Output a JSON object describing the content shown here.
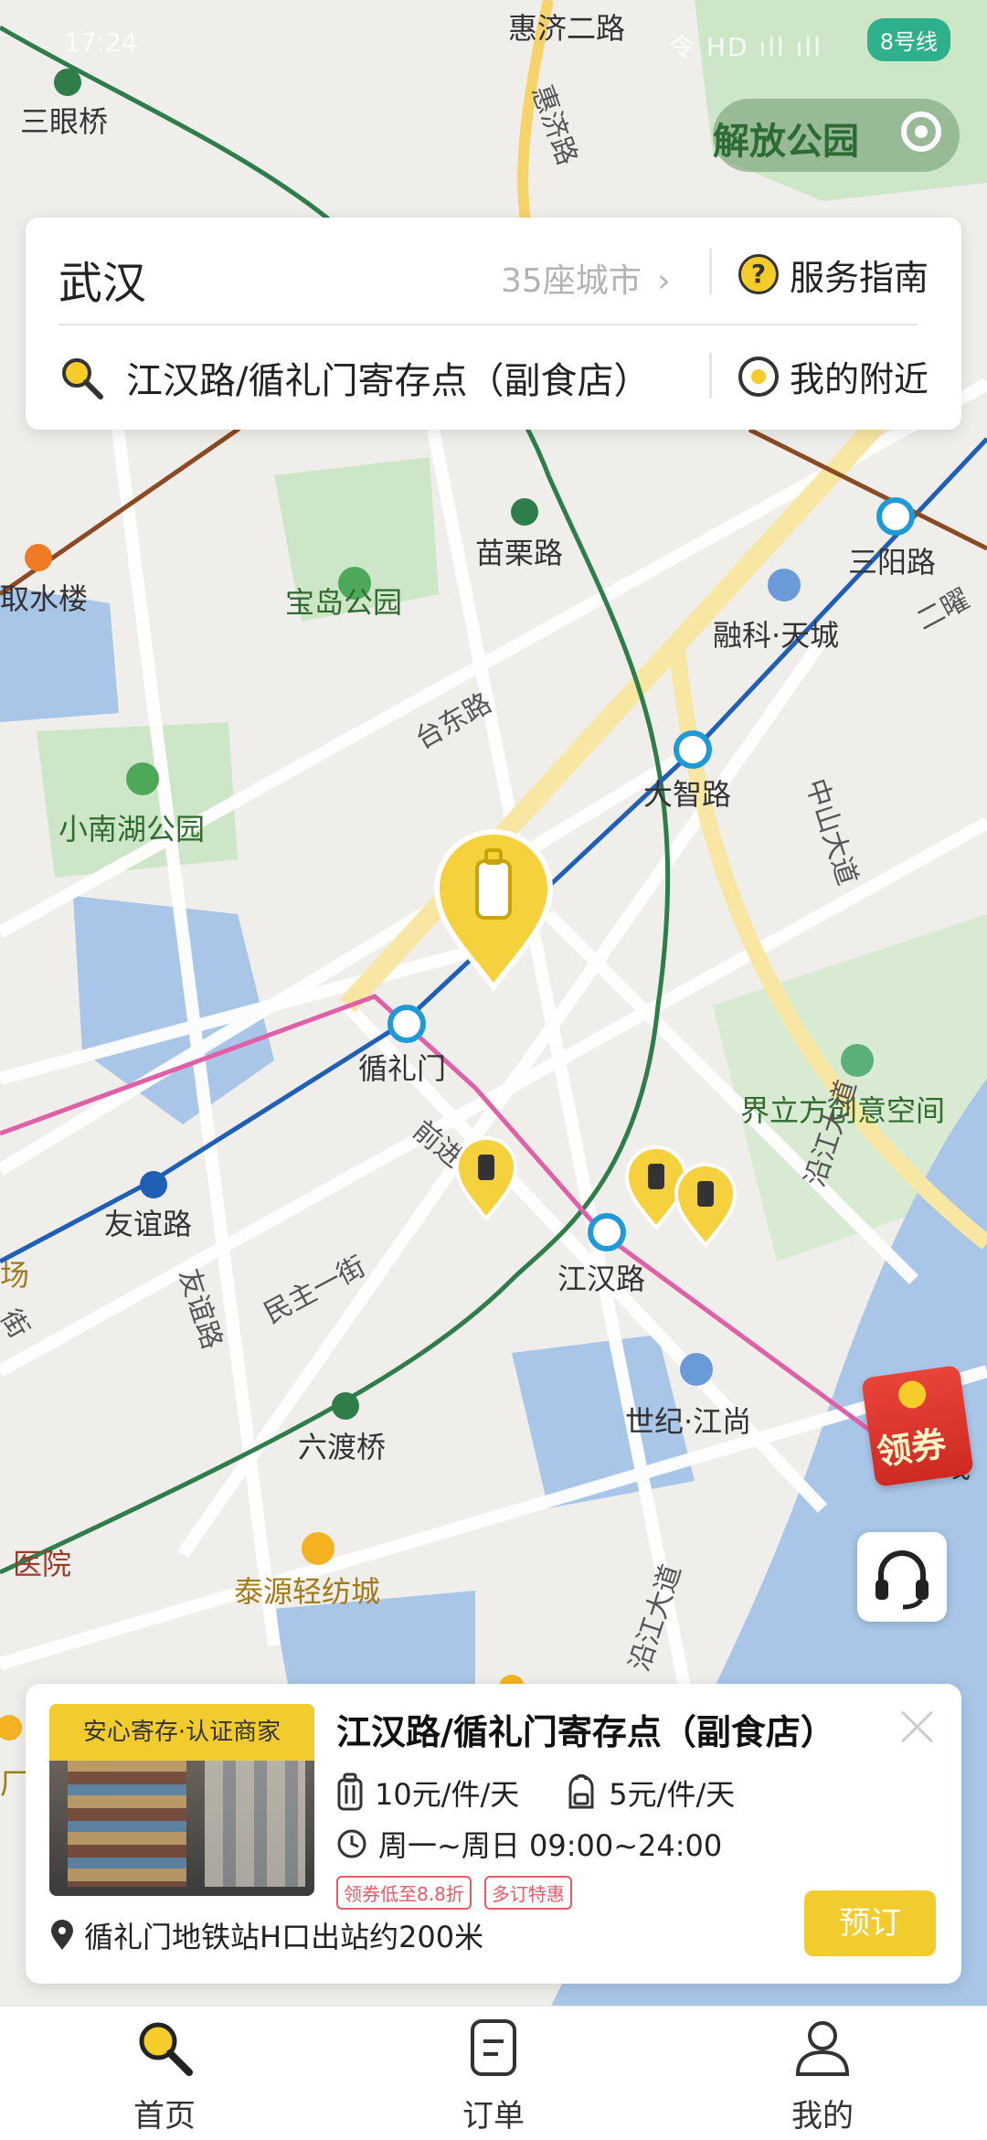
{
  "status_bar": {
    "time": "17:24",
    "icons": "令 HD ıll ıll",
    "line_badge": "8号线"
  },
  "map": {
    "park_chip": "解放公园",
    "labels": {
      "huiji_er_road": "惠济二路",
      "huiji_road": "惠济路",
      "sanyanqiao": "三眼桥",
      "miaoli_road": "苗栗路",
      "sanyang_road": "三阳路",
      "qushuilou": "取水楼",
      "baodao_park": "宝岛公园",
      "rongke_tiancheng": "融科·天城",
      "erlao": "二曜",
      "taidong_road": "台东路",
      "dazhi_road": "大智路",
      "zhongshan_avenue": "中山大道",
      "xiaonanhu_park": "小南湖公园",
      "xunlimen": "循礼门",
      "jielifang": "界立方创意空间",
      "youyi_road": "友谊路",
      "youyi_road_2": "友谊路",
      "qianjin_road": "前进一路",
      "minzhu_street": "民主一街",
      "jianghan_road": "江汉路",
      "yanjiang_avenue": "沿江大道",
      "yanjiang_avenue_2": "沿江大道",
      "shiji_jiangshang": "世纪·江尚",
      "liuduqiao": "六渡桥",
      "yiyuan": "医院",
      "taiyuan": "泰源轻纺城",
      "chang": "场",
      "jie": "街",
      "chang2": "厂",
      "xian": "线"
    }
  },
  "top_card": {
    "city": "武汉",
    "city_count": "35座城市",
    "guide": "服务指南",
    "search_value": "江汉路/循礼门寄存点（副食店）",
    "nearby": "我的附近"
  },
  "coupon": "领券",
  "shop": {
    "badge": "安心寄存·认证商家",
    "title": "江汉路/循礼门寄存点（副食店）",
    "price_large": "10元/件/天",
    "price_small": "5元/件/天",
    "hours": "周一~周日 09:00~24:00",
    "tags": [
      "领券低至8.8折",
      "多订特惠"
    ],
    "address": "循礼门地铁站H口出站约200米",
    "book": "预订"
  },
  "tabs": [
    {
      "label": "首页",
      "icon": "search-icon",
      "active": true
    },
    {
      "label": "订单",
      "icon": "order-icon",
      "active": false
    },
    {
      "label": "我的",
      "icon": "user-icon",
      "active": false
    }
  ],
  "colors": {
    "accent": "#f2cc2f",
    "line_green": "#2f7d4a",
    "line_blue": "#1f5fb5",
    "line_pink": "#e060a8",
    "line_brown": "#8a4a22",
    "water": "#a9c6e8",
    "park": "#cde6c7"
  }
}
